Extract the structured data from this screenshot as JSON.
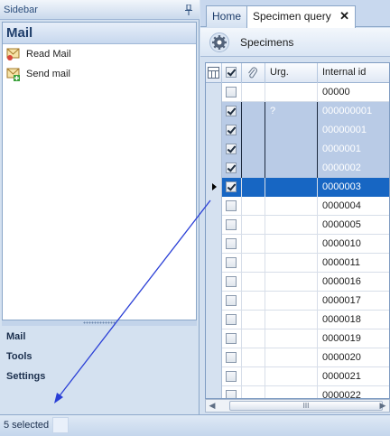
{
  "sidebar": {
    "title": "Sidebar",
    "heading": "Mail",
    "items": [
      {
        "label": "Read Mail",
        "icon": "read-mail-icon"
      },
      {
        "label": "Send mail",
        "icon": "send-mail-icon"
      }
    ],
    "nav": [
      {
        "label": "Mail"
      },
      {
        "label": "Tools"
      },
      {
        "label": "Settings"
      }
    ]
  },
  "tabs": [
    {
      "label": "Home",
      "active": false
    },
    {
      "label": "Specimen query",
      "active": true,
      "close": "✕"
    }
  ],
  "toolbar": {
    "label": "Specimens",
    "icon": "gear-icon"
  },
  "grid": {
    "headers": [
      "",
      "",
      "Urg.",
      "Internal id"
    ],
    "rows": [
      {
        "id": "00000",
        "urg": "",
        "checked": false,
        "state": "normal"
      },
      {
        "id": "000000001",
        "urg": "?",
        "checked": true,
        "state": "selected"
      },
      {
        "id": "00000001",
        "urg": "",
        "checked": true,
        "state": "selected"
      },
      {
        "id": "0000001",
        "urg": "",
        "checked": true,
        "state": "selected"
      },
      {
        "id": "0000002",
        "urg": "",
        "checked": true,
        "state": "selected"
      },
      {
        "id": "0000003",
        "urg": "",
        "checked": true,
        "state": "current"
      },
      {
        "id": "0000004",
        "urg": "",
        "checked": false,
        "state": "normal"
      },
      {
        "id": "0000005",
        "urg": "",
        "checked": false,
        "state": "normal"
      },
      {
        "id": "0000010",
        "urg": "",
        "checked": false,
        "state": "normal"
      },
      {
        "id": "0000011",
        "urg": "",
        "checked": false,
        "state": "normal"
      },
      {
        "id": "0000016",
        "urg": "",
        "checked": false,
        "state": "normal"
      },
      {
        "id": "0000017",
        "urg": "",
        "checked": false,
        "state": "normal"
      },
      {
        "id": "0000018",
        "urg": "",
        "checked": false,
        "state": "normal"
      },
      {
        "id": "0000019",
        "urg": "",
        "checked": false,
        "state": "normal"
      },
      {
        "id": "0000020",
        "urg": "",
        "checked": false,
        "state": "normal"
      },
      {
        "id": "0000021",
        "urg": "",
        "checked": false,
        "state": "normal"
      },
      {
        "id": "0000022",
        "urg": "",
        "checked": false,
        "state": "normal"
      }
    ],
    "scroll_thumb_label": "III"
  },
  "status": {
    "text": "5 selected"
  },
  "colors": {
    "selection": "#b9cbe6",
    "current_row": "#1766c3",
    "annotation_arrow": "#2a3fd6"
  }
}
